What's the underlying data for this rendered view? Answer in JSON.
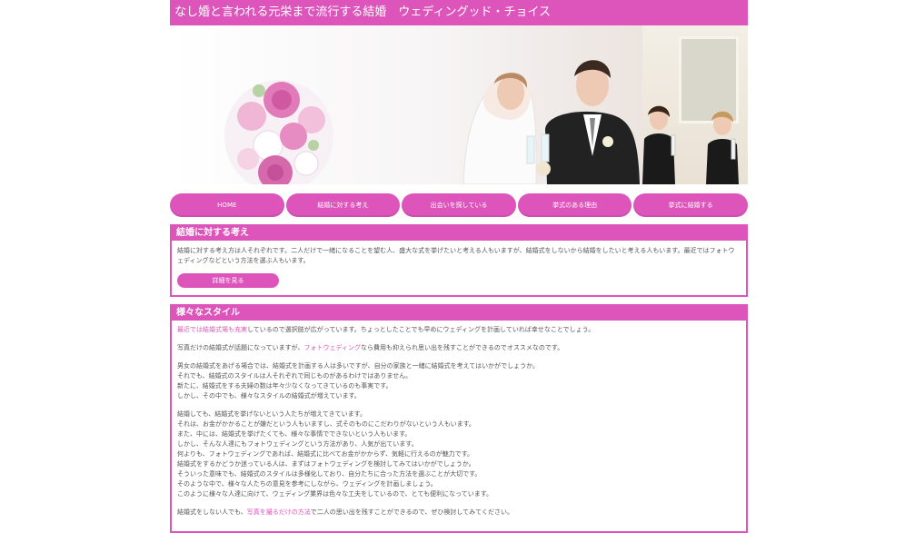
{
  "header": {
    "title": "なし婚と言われる元栄まで流行する結婚　ウェディングッド・チョイス"
  },
  "nav": [
    {
      "label": "HOME"
    },
    {
      "label": "結婚に対する考え"
    },
    {
      "label": "出会いを探している"
    },
    {
      "label": "挙式のある理由"
    },
    {
      "label": "挙式に結婚する"
    }
  ],
  "panel1": {
    "title": "結婚に対する考え",
    "text": "結婚に対する考え方は人それぞれです。二人だけで一緒になることを望む人、盛大な式を挙げたいと考える人もいますが、結婚式をしないから結婚をしたいと考える人もいます。最近ではフォトウェディングなどという方法を選ぶ人もいます。",
    "button": "詳細を見る"
  },
  "panel2": {
    "title": "様々なスタイル",
    "lines": [
      {
        "pre": "",
        "link": "最近では結婚式場も充実",
        "post": "しているので選択肢が広がっています。ちょっとしたことでも早めにウェディングを計画していれば幸せなことでしょう。"
      },
      {
        "pre": "写真だけの結婚式が話題になっていますが、",
        "link": "フォトウェディング",
        "post": "なら費用も抑えられ思い出を残すことができるのでオススメなのです。"
      },
      {
        "pre": "男女の結婚式をあげる場合では、結婚式を計画する人は多いですが、自分の家族と一緒に結婚式を考えてはいかがでしょうか。",
        "link": "",
        "post": ""
      },
      {
        "pre": "それでも、結婚式のスタイルは人それぞれで同じものがあるわけではありません。",
        "link": "",
        "post": ""
      },
      {
        "pre": "新たに、結婚式をする夫婦の数は年々少なくなってきているのも事実です。",
        "link": "",
        "post": ""
      },
      {
        "pre": "しかし、その中でも、様々なスタイルの結婚式が増えています。",
        "link": "",
        "post": ""
      },
      {
        "pre": "結婚しても、結婚式を挙げないという人たちが増えてきています。",
        "link": "",
        "post": ""
      },
      {
        "pre": "それは、お金がかかることが嫌だという人もいますし、式そのものにこだわりがないという人もいます。",
        "link": "",
        "post": ""
      },
      {
        "pre": "また、中には、結婚式を挙げたくても、様々な事情でできないという人もいます。",
        "link": "",
        "post": ""
      },
      {
        "pre": "しかし、そんな人達にもフォトウェディングという方法があり、人気が出ています。",
        "link": "",
        "post": ""
      },
      {
        "pre": "何よりも、フォトウェディングであれば、結婚式に比べてお金がかからず、気軽に行えるのが魅力です。",
        "link": "",
        "post": ""
      },
      {
        "pre": "結婚式をするかどうか迷っている人は、まずはフォトウェディングを検討してみてはいかがでしょうか。",
        "link": "",
        "post": ""
      },
      {
        "pre": "そういった意味でも、結婚式のスタイルは多様化しており、自分たちに合った方法を選ぶことが大切です。",
        "link": "",
        "post": ""
      },
      {
        "pre": "そのような中で、様々な人たちの意見を参考にしながら、ウェディングを計画しましょう。",
        "link": "",
        "post": ""
      },
      {
        "pre": "このように様々な人達に向けて、ウェディング業界は色々な工夫をしているので、とても便利になっています。",
        "link": "",
        "post": ""
      },
      {
        "pre": "結婚式をしない人でも、",
        "link": "写真を撮るだけの方法",
        "post": "で二人の思い出を残すことができるので、ぜひ検討してみてください。"
      }
    ]
  }
}
